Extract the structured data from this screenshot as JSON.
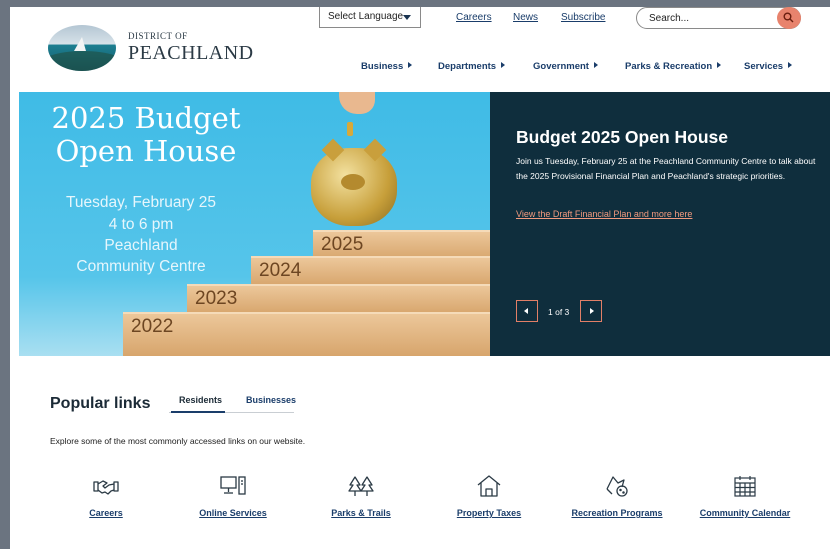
{
  "header": {
    "logo_small": "DISTRICT OF",
    "logo_big": "PEACHLAND",
    "language_select": "Select Language",
    "utility_links": [
      "Careers",
      "News",
      "Subscribe"
    ],
    "search_placeholder": "Search...",
    "nav": [
      "Business",
      "Departments",
      "Government",
      "Parks & Recreation",
      "Services"
    ]
  },
  "hero": {
    "image_title": "2025 Budget Open House",
    "image_date": "Tuesday, February 25",
    "image_time": "4 to 6 pm",
    "image_place_1": "Peachland",
    "image_place_2": "Community Centre",
    "steps": [
      "2022",
      "2023",
      "2024",
      "2025"
    ],
    "title": "Budget 2025 Open House",
    "text": "Join us Tuesday, February 25 at the Peachland Community Centre to talk about the 2025 Provisional Financial Plan and Peachland's strategic priorities.",
    "link": "View the Draft Financial Plan and more here",
    "counter": "1 of 3"
  },
  "popular": {
    "title": "Popular links",
    "tabs": [
      "Residents",
      "Businesses"
    ],
    "description": "Explore some of the most commonly accessed links on our website.",
    "links": [
      {
        "label": "Careers",
        "icon": "handshake-icon"
      },
      {
        "label": "Online Services",
        "icon": "computer-icon"
      },
      {
        "label": "Parks & Trails",
        "icon": "trees-icon"
      },
      {
        "label": "Property Taxes",
        "icon": "house-icon"
      },
      {
        "label": "Recreation Programs",
        "icon": "recreation-icon"
      },
      {
        "label": "Community Calendar",
        "icon": "calendar-icon"
      }
    ]
  },
  "colors": {
    "accent": "#e8836d",
    "navy": "#1a3d6a",
    "panel": "#0f2e3d",
    "sky": "#3fbbe6"
  }
}
